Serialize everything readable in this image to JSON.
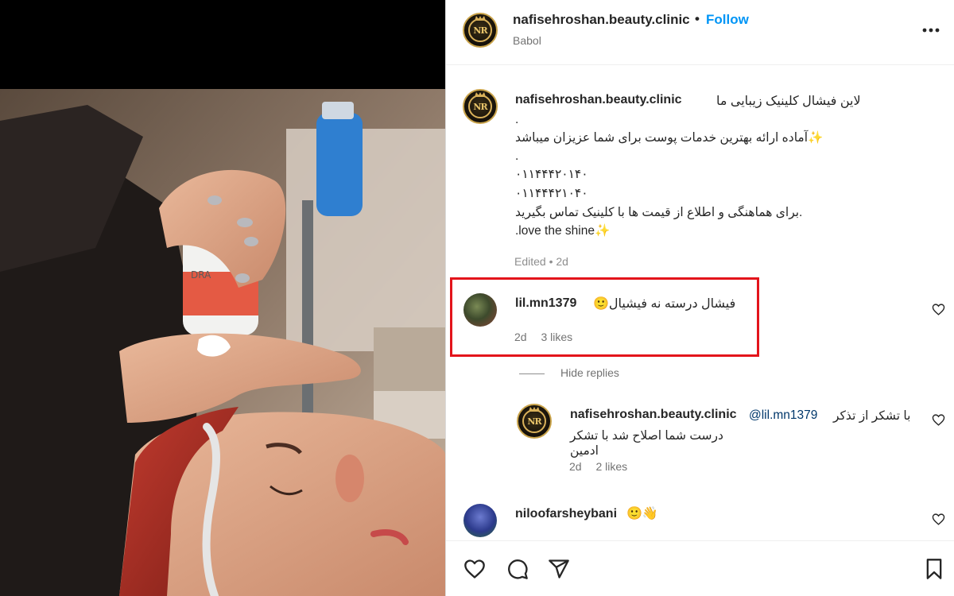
{
  "post": {
    "author": "nafisehroshan.beauty.clinic",
    "follow_label": "Follow",
    "dot": "•",
    "location": "Babol",
    "more_icon": "more-horizontal-icon",
    "avatar_initials": "NR"
  },
  "caption": {
    "username": "nafisehroshan.beauty.clinic",
    "line1": "لاین فیشال کلینیک زیبایی ما",
    "line2": ".",
    "line3": "✨آماده ارائه بهترین خدمات پوست برای شما عزیزان میباشد",
    "line4": ".",
    "line5": "۰۱۱۴۴۴۲۰۱۴۰",
    "line6": "۰۱۱۴۴۴۲۱۰۴۰",
    "line7": ".برای هماهنگی و اطلاع از قیمت ها با کلینیک تماس بگیرید",
    "line8": ".love the shine✨",
    "edited": "Edited • 2d"
  },
  "comments": [
    {
      "username": "lil.mn1379",
      "text": "فیشال درسته نه فیشیال🙂",
      "age": "2d",
      "likes": "3 likes",
      "highlighted": true
    }
  ],
  "hide_replies": "Hide replies",
  "reply": {
    "username": "nafisehroshan.beauty.clinic",
    "mention": "@lil.mn1379",
    "text1": "با تشکر از تذکر",
    "text2": "درست شما اصلاح شد با تشکر ادمین",
    "age": "2d",
    "likes": "2 likes"
  },
  "next_comment": {
    "username": "niloofarsheybani",
    "emoji": "🙂👋"
  },
  "actions": {
    "like_icon": "heart-icon",
    "comment_icon": "comment-icon",
    "share_icon": "share-icon",
    "save_icon": "bookmark-icon"
  },
  "colors": {
    "follow": "#0095f6",
    "highlight": "#e3141b",
    "muted": "#737373",
    "mention": "#00376b"
  }
}
